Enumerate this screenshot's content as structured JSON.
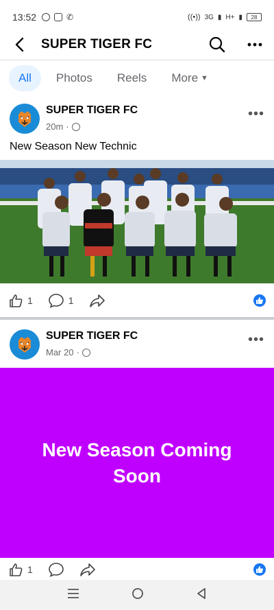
{
  "status_bar": {
    "time": "13:52",
    "network": "3G",
    "network2": "H+",
    "battery": "28"
  },
  "header": {
    "title": "SUPER TIGER FC"
  },
  "tabs": [
    {
      "label": "All",
      "active": true
    },
    {
      "label": "Photos",
      "active": false
    },
    {
      "label": "Reels",
      "active": false
    },
    {
      "label": "More",
      "active": false
    }
  ],
  "posts": [
    {
      "author": "SUPER TIGER FC",
      "time": "20m",
      "caption": "New Season New Technic",
      "likes": "1",
      "comments": "1"
    },
    {
      "author": "SUPER TIGER FC",
      "time": "Mar 20",
      "banner_text": "New Season Coming Soon",
      "banner_color": "#c000ff",
      "likes": "1"
    }
  ],
  "colors": {
    "accent": "#1877f2",
    "muted": "#65676b"
  }
}
